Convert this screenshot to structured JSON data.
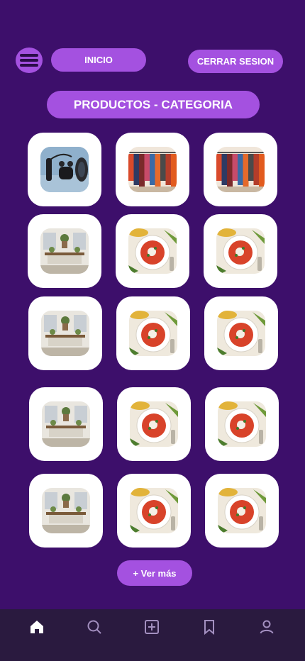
{
  "header": {
    "inicio_label": "INICIO",
    "cerrar_label": "CERRAR SESION"
  },
  "section": {
    "title": "PRODUCTOS - CATEGORIA"
  },
  "products": [
    {
      "image": "electronics-image"
    },
    {
      "image": "clothing-rack-image"
    },
    {
      "image": "clothing-rack-image"
    },
    {
      "image": "living-room-image"
    },
    {
      "image": "soup-bowl-image"
    },
    {
      "image": "soup-bowl-image"
    },
    {
      "image": "living-room-image"
    },
    {
      "image": "soup-bowl-image"
    },
    {
      "image": "soup-bowl-image"
    },
    {
      "image": "living-room-image"
    },
    {
      "image": "soup-bowl-image"
    },
    {
      "image": "soup-bowl-image"
    },
    {
      "image": "living-room-image"
    },
    {
      "image": "soup-bowl-image"
    },
    {
      "image": "soup-bowl-image"
    }
  ],
  "more_button": {
    "label": "+ Ver más"
  },
  "tabbar": {
    "icons": [
      "home-icon",
      "search-icon",
      "add-square-icon",
      "bookmark-icon",
      "user-icon"
    ],
    "active": "home-icon"
  },
  "colors": {
    "background": "#3d0f6b",
    "accent": "#a451e0",
    "tabbar": "#2a1a3f",
    "card": "#ffffff"
  }
}
